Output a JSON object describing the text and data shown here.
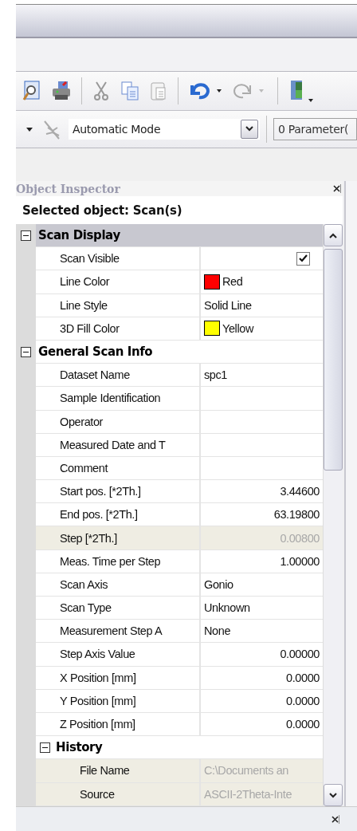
{
  "toolbar": {
    "redo_disabled": true
  },
  "mode_bar": {
    "mode": "Automatic Mode",
    "parameters": "0 Parameter("
  },
  "inspector": {
    "title": "Object Inspector",
    "selected_object": "Selected object: Scan(s)",
    "groups": [
      {
        "kind": "group",
        "title": "Scan Display",
        "expanded": true,
        "selected": true,
        "children": [
          {
            "kind": "check",
            "name": "Scan Visible",
            "checked": true,
            "disabled": false
          },
          {
            "kind": "color",
            "name": "Line Color",
            "value": "Red",
            "color": "#ff0000",
            "disabled": false
          },
          {
            "kind": "text",
            "name": "Line Style",
            "value": "Solid Line",
            "disabled": false
          },
          {
            "kind": "color",
            "name": "3D Fill Color",
            "value": "Yellow",
            "color": "#ffff00",
            "disabled": false
          }
        ]
      },
      {
        "kind": "group",
        "title": "General Scan Info",
        "expanded": true,
        "selected": false,
        "children": [
          {
            "kind": "text",
            "name": "Dataset Name",
            "value": "spc1",
            "disabled": false
          },
          {
            "kind": "text",
            "name": "Sample Identification",
            "disabled": false
          },
          {
            "kind": "text",
            "name": "Operator",
            "disabled": false
          },
          {
            "kind": "text",
            "name": "Measured Date and T",
            "disabled": false
          },
          {
            "kind": "text",
            "name": "Comment",
            "disabled": false
          },
          {
            "kind": "number",
            "name": "Start pos. [*2Th.]",
            "value": "3.44600",
            "disabled": false
          },
          {
            "kind": "number",
            "name": "End pos. [*2Th.]",
            "value": "63.19800",
            "disabled": false
          },
          {
            "kind": "number",
            "name": "Step [*2Th.]",
            "value": "0.00800",
            "disabled": true
          },
          {
            "kind": "number",
            "name": "Meas. Time per Step",
            "value": "1.00000",
            "disabled": false
          },
          {
            "kind": "text",
            "name": "Scan Axis",
            "value": "Gonio",
            "disabled": false
          },
          {
            "kind": "text",
            "name": "Scan Type",
            "value": "Unknown",
            "disabled": false
          },
          {
            "kind": "text",
            "name": "Measurement Step A",
            "value": "None",
            "disabled": false
          },
          {
            "kind": "number",
            "name": "Step Axis Value",
            "value": "0.00000",
            "disabled": false
          },
          {
            "kind": "number",
            "name": "X Position [mm]",
            "value": "0.0000",
            "disabled": false
          },
          {
            "kind": "number",
            "name": "Y Position [mm]",
            "value": "0.0000",
            "disabled": false
          },
          {
            "kind": "number",
            "name": "Z Position [mm]",
            "value": "0.0000",
            "disabled": false
          },
          {
            "kind": "group",
            "title": "History",
            "expanded": true,
            "selected": false,
            "children": [
              {
                "kind": "text",
                "name": "File Name",
                "value": "C:\\Documents an",
                "disabled": true
              },
              {
                "kind": "text",
                "name": "Source",
                "value": "ASCII-2Theta-Inte",
                "disabled": true
              }
            ]
          }
        ]
      }
    ]
  }
}
